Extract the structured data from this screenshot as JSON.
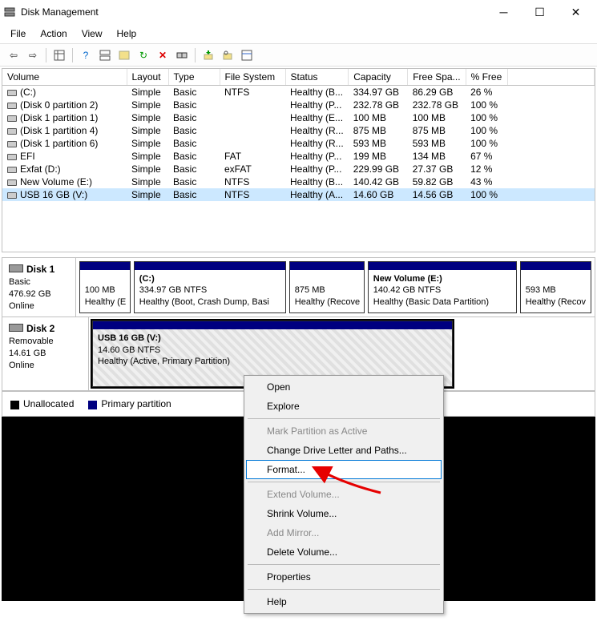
{
  "window": {
    "title": "Disk Management"
  },
  "menu": {
    "file": "File",
    "action": "Action",
    "view": "View",
    "help": "Help"
  },
  "columns": {
    "volume": "Volume",
    "layout": "Layout",
    "type": "Type",
    "fs": "File System",
    "status": "Status",
    "capacity": "Capacity",
    "free": "Free Spa...",
    "pct": "% Free"
  },
  "volumes": [
    {
      "name": "(C:)",
      "layout": "Simple",
      "type": "Basic",
      "fs": "NTFS",
      "status": "Healthy (B...",
      "capacity": "334.97 GB",
      "free": "86.29 GB",
      "pct": "26 %"
    },
    {
      "name": "(Disk 0 partition 2)",
      "layout": "Simple",
      "type": "Basic",
      "fs": "",
      "status": "Healthy (P...",
      "capacity": "232.78 GB",
      "free": "232.78 GB",
      "pct": "100 %"
    },
    {
      "name": "(Disk 1 partition 1)",
      "layout": "Simple",
      "type": "Basic",
      "fs": "",
      "status": "Healthy (E...",
      "capacity": "100 MB",
      "free": "100 MB",
      "pct": "100 %"
    },
    {
      "name": "(Disk 1 partition 4)",
      "layout": "Simple",
      "type": "Basic",
      "fs": "",
      "status": "Healthy (R...",
      "capacity": "875 MB",
      "free": "875 MB",
      "pct": "100 %"
    },
    {
      "name": "(Disk 1 partition 6)",
      "layout": "Simple",
      "type": "Basic",
      "fs": "",
      "status": "Healthy (R...",
      "capacity": "593 MB",
      "free": "593 MB",
      "pct": "100 %"
    },
    {
      "name": "EFI",
      "layout": "Simple",
      "type": "Basic",
      "fs": "FAT",
      "status": "Healthy (P...",
      "capacity": "199 MB",
      "free": "134 MB",
      "pct": "67 %"
    },
    {
      "name": "Exfat (D:)",
      "layout": "Simple",
      "type": "Basic",
      "fs": "exFAT",
      "status": "Healthy (P...",
      "capacity": "229.99 GB",
      "free": "27.37 GB",
      "pct": "12 %"
    },
    {
      "name": "New Volume (E:)",
      "layout": "Simple",
      "type": "Basic",
      "fs": "NTFS",
      "status": "Healthy (B...",
      "capacity": "140.42 GB",
      "free": "59.82 GB",
      "pct": "43 %"
    },
    {
      "name": "USB 16 GB (V:)",
      "layout": "Simple",
      "type": "Basic",
      "fs": "NTFS",
      "status": "Healthy (A...",
      "capacity": "14.60 GB",
      "free": "14.56 GB",
      "pct": "100 %",
      "selected": true
    }
  ],
  "disk1": {
    "name": "Disk 1",
    "type": "Basic",
    "size": "476.92 GB",
    "status": "Online",
    "p1": {
      "l1": "100 MB",
      "l2": "Healthy (E"
    },
    "p2": {
      "l1": "(C:)",
      "l2": "334.97 GB NTFS",
      "l3": "Healthy (Boot, Crash Dump, Basi"
    },
    "p3": {
      "l1": "875 MB",
      "l2": "Healthy (Recove"
    },
    "p4": {
      "l1": "New Volume  (E:)",
      "l2": "140.42 GB NTFS",
      "l3": "Healthy (Basic Data Partition)"
    },
    "p5": {
      "l1": "593 MB",
      "l2": "Healthy (Recov"
    }
  },
  "disk2": {
    "name": "Disk 2",
    "type": "Removable",
    "size": "14.61 GB",
    "status": "Online",
    "p1": {
      "l1": "USB 16 GB  (V:)",
      "l2": "14.60 GB NTFS",
      "l3": "Healthy (Active, Primary Partition)"
    }
  },
  "legend": {
    "unallocated": "Unallocated",
    "primary": "Primary partition"
  },
  "context": {
    "open": "Open",
    "explore": "Explore",
    "mark": "Mark Partition as Active",
    "change": "Change Drive Letter and Paths...",
    "format": "Format...",
    "extend": "Extend Volume...",
    "shrink": "Shrink Volume...",
    "mirror": "Add Mirror...",
    "delete": "Delete Volume...",
    "properties": "Properties",
    "help": "Help"
  }
}
